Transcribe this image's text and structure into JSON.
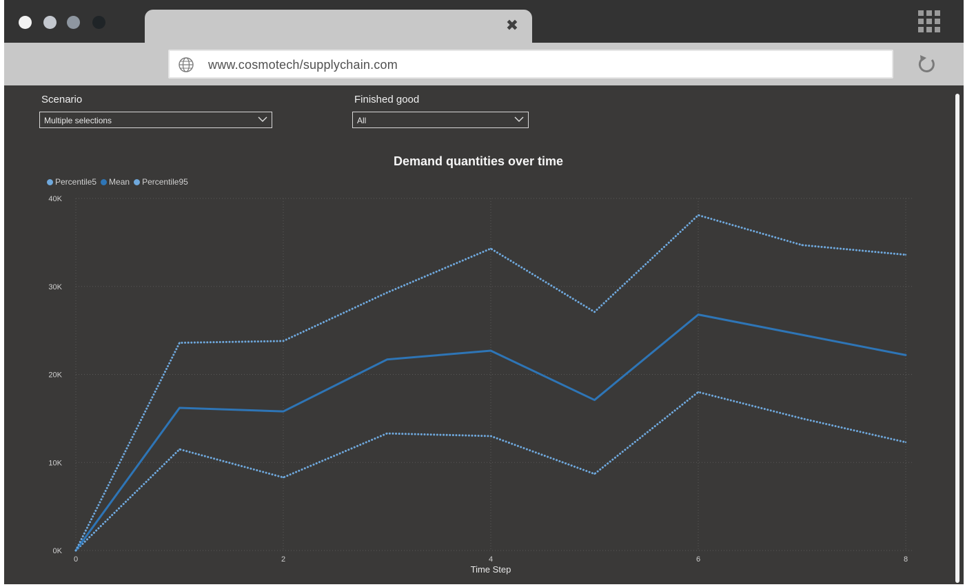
{
  "browser": {
    "window_dots": [
      {
        "name": "close-dot",
        "color": "#f2f2f2"
      },
      {
        "name": "minimize-dot",
        "color": "#c4c8cf"
      },
      {
        "name": "maximize-dot",
        "color": "#8e96a0"
      },
      {
        "name": "dark-dot",
        "color": "#1f2427"
      }
    ],
    "tab_close_icon": "close-icon",
    "apps_icon": "apps-grid-icon",
    "url": "www.cosmotech/supplychain.com",
    "url_icon": "globe-icon",
    "reload_icon": "reload-icon"
  },
  "filters": {
    "scenario": {
      "label": "Scenario",
      "value": "Multiple selections"
    },
    "finished_good": {
      "label": "Finished good",
      "value": "All"
    }
  },
  "chart_data": {
    "type": "line",
    "title": "Demand quantities over time",
    "xlabel": "Time Step",
    "ylabel": "",
    "x": [
      0,
      1,
      2,
      3,
      4,
      5,
      6,
      7,
      8
    ],
    "x_ticks": [
      "0",
      "2",
      "4",
      "6",
      "8"
    ],
    "y_ticks": [
      "0K",
      "10K",
      "20K",
      "30K",
      "40K"
    ],
    "xlim": [
      0,
      8
    ],
    "ylim": [
      0,
      40000
    ],
    "grid": true,
    "legend_position": "top-left",
    "series": [
      {
        "name": "Percentile5",
        "color": "#6fa8dc",
        "style": "dotted",
        "values": [
          0,
          11500,
          8300,
          13300,
          13000,
          8700,
          18000,
          15000,
          12300
        ]
      },
      {
        "name": "Mean",
        "color": "#2e75b6",
        "style": "solid",
        "values": [
          0,
          16200,
          15800,
          21700,
          22700,
          17100,
          26800,
          24500,
          22200
        ]
      },
      {
        "name": "Percentile95",
        "color": "#6fa8dc",
        "style": "dotted",
        "values": [
          0,
          23600,
          23800,
          29300,
          34300,
          27100,
          38100,
          34700,
          33600
        ]
      }
    ]
  }
}
